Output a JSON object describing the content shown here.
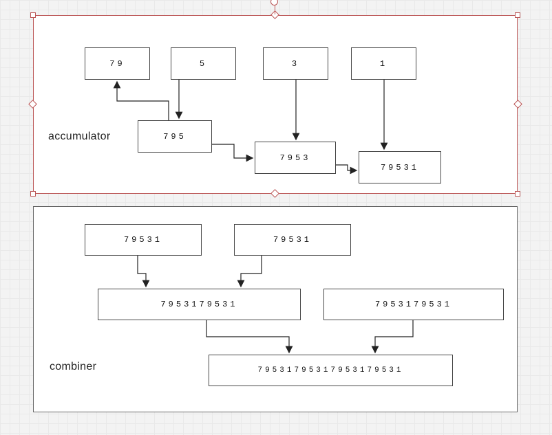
{
  "panel1_label": "accumulator",
  "panel2_label": "combiner",
  "acc": {
    "b79": "79",
    "b5": "5",
    "b3": "3",
    "b1": "1",
    "b795": "795",
    "b7953": "7953",
    "b79531": "79531"
  },
  "comb": {
    "b79531a": "79531",
    "b79531b": "79531",
    "blong1": "7953179531",
    "blong2": "7953179531",
    "bfinal": "79531795317953179531"
  }
}
